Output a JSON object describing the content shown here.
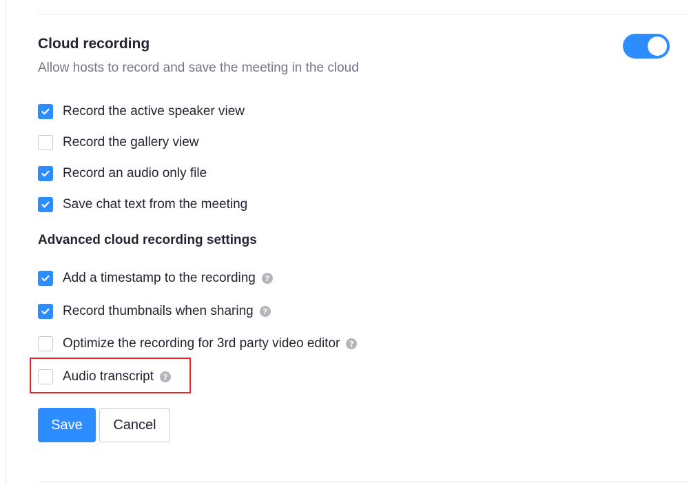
{
  "cloud_recording": {
    "title": "Cloud recording",
    "description": "Allow hosts to record and save the meeting in the cloud",
    "enabled": true,
    "toggle_color": "#2d8cff"
  },
  "options": [
    {
      "label": "Record the active speaker view",
      "checked": true
    },
    {
      "label": "Record the gallery view",
      "checked": false
    },
    {
      "label": "Record an audio only file",
      "checked": true
    },
    {
      "label": "Save chat text from the meeting",
      "checked": true
    }
  ],
  "advanced": {
    "heading": "Advanced cloud recording settings",
    "options": [
      {
        "label": "Add a timestamp to the recording",
        "checked": true,
        "help_icon": "question-circle-icon"
      },
      {
        "label": "Record thumbnails when sharing",
        "checked": true,
        "help_icon": "question-circle-icon"
      },
      {
        "label": "Optimize the recording for 3rd party video editor",
        "checked": false,
        "help_icon": "question-circle-icon"
      },
      {
        "label": "Audio transcript",
        "checked": false,
        "help_icon": "question-circle-icon",
        "highlighted": true
      }
    ]
  },
  "help_glyph": "?",
  "highlight_color": "#e5262a",
  "buttons": {
    "save_label": "Save",
    "cancel_label": "Cancel"
  }
}
